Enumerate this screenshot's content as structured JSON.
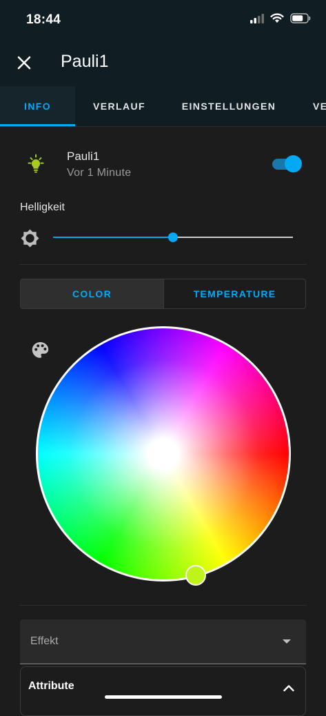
{
  "status_bar": {
    "time": "18:44"
  },
  "dialog": {
    "title": "Pauli1",
    "close_icon": "close-icon"
  },
  "tabs": [
    {
      "label": "INFO",
      "active": true
    },
    {
      "label": "VERLAUF",
      "active": false
    },
    {
      "label": "EINSTELLUNGEN",
      "active": false
    },
    {
      "label": "VE",
      "active": false
    }
  ],
  "entity": {
    "name": "Pauli1",
    "last_changed": "Vor 1 Minute",
    "icon": "lightbulb-icon",
    "icon_color": "#a6cc1f",
    "state_on": true
  },
  "brightness": {
    "label": "Helligkeit",
    "value_fraction": 0.5,
    "icon": "brightness-icon"
  },
  "color_mode": {
    "options": [
      {
        "label": "COLOR",
        "active": true
      },
      {
        "label": "TEMPERATURE",
        "active": false
      }
    ]
  },
  "color_wheel": {
    "palette_icon": "palette-icon",
    "selected_color": "#bff41a",
    "selected_hue_deg": 75,
    "selected_saturation": 1.0
  },
  "effect_select": {
    "label": "Effekt",
    "icon": "arrow-dropdown-icon"
  },
  "attributes": {
    "label": "Attribute",
    "icon": "chevron-up-icon",
    "expanded": true
  },
  "colors": {
    "accent": "#03a9f4",
    "header": "#101e24",
    "background": "#1c1c1c"
  }
}
